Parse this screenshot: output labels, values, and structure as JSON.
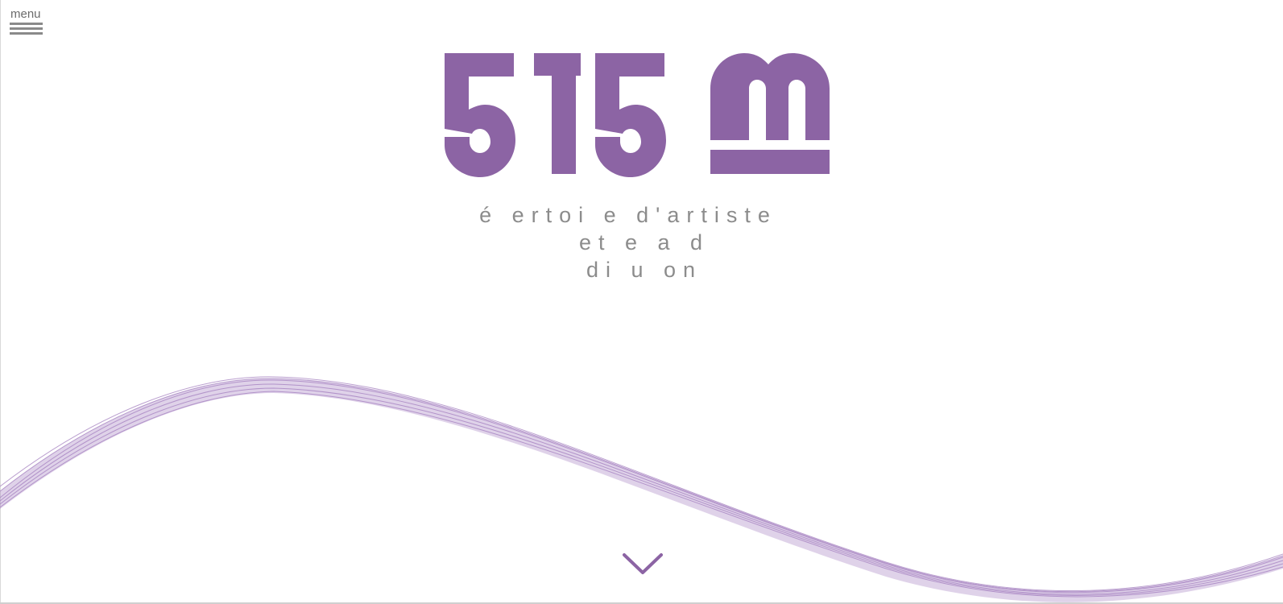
{
  "header": {
    "menu_label": "menu",
    "menu_icon": "hamburger-icon"
  },
  "logo": {
    "text": "515 m",
    "color": "#8c64a4"
  },
  "tagline": {
    "line1": "é ertoi e d'artiste",
    "line2": "et e a d",
    "line3": "di u on"
  },
  "decor": {
    "wave_color": "#a47fbf"
  },
  "scroll": {
    "icon": "chevron-down-icon"
  }
}
